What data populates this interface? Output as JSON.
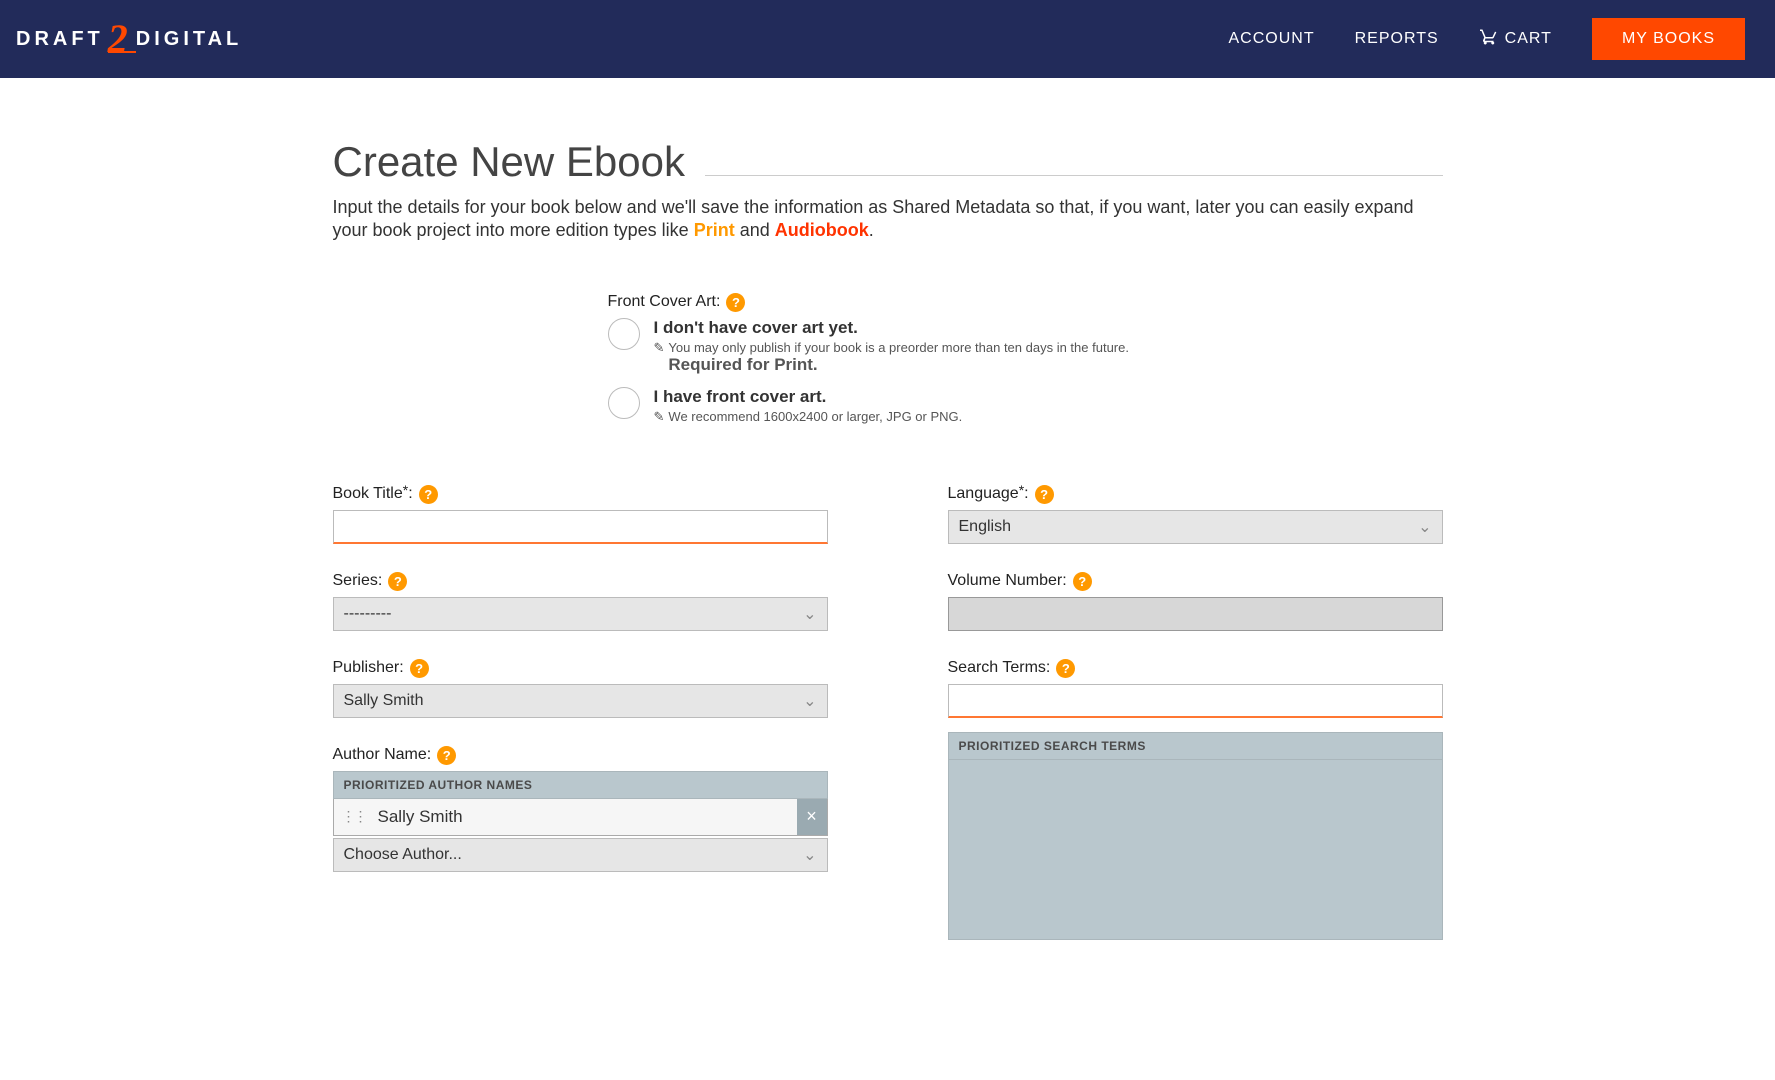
{
  "nav": {
    "logo_left": "DRAFT",
    "logo_mid": "2",
    "logo_right": "DIGITAL",
    "account": "ACCOUNT",
    "reports": "REPORTS",
    "cart": "CART",
    "mybooks": "MY BOOKS"
  },
  "page": {
    "title": "Create New Ebook",
    "intro_pre": "Input the details for your book below and we'll save the information as Shared Metadata so that, if you want, later you can easily expand your book project into more edition types like ",
    "print": "Print",
    "intro_and": " and ",
    "audio": "Audiobook",
    "intro_post": "."
  },
  "cover": {
    "label": "Front Cover Art:",
    "opt1_title": "I don't have cover art yet.",
    "opt1_sub_a": "You may only publish if your book is a preorder more than ten days in the future. ",
    "opt1_sub_b": "Required for Print.",
    "opt2_title": "I have front cover art.",
    "opt2_sub": "We recommend 1600x2400 or larger, JPG or PNG."
  },
  "left": {
    "book_title_label": "Book Title",
    "series_label": "Series:",
    "series_value": "---------",
    "publisher_label": "Publisher:",
    "publisher_value": "Sally Smith",
    "author_label": "Author Name:",
    "author_panel": "PRIORITIZED AUTHOR NAMES",
    "author_item": "Sally Smith",
    "author_choose": "Choose Author..."
  },
  "right": {
    "language_label": "Language",
    "language_value": "English",
    "volume_label": "Volume Number:",
    "search_label": "Search Terms:",
    "search_panel": "PRIORITIZED SEARCH TERMS"
  }
}
